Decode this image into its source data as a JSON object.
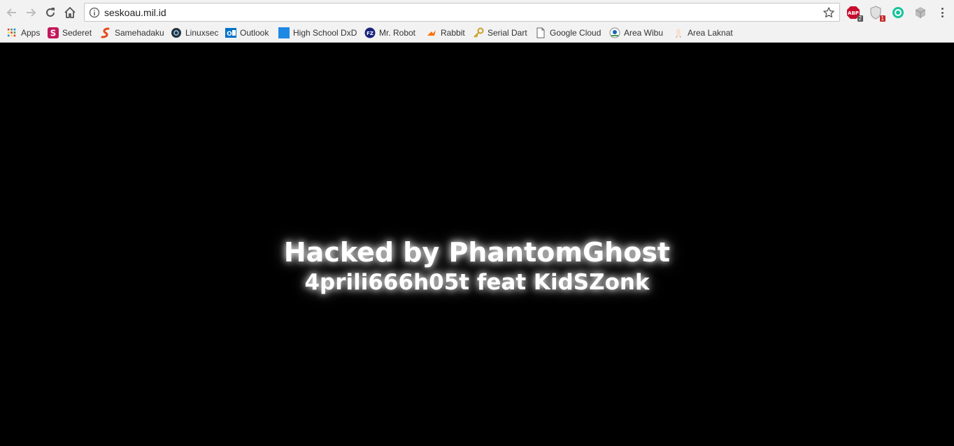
{
  "browser": {
    "url": "seskoau.mil.id",
    "extensions": [
      {
        "name": "adblock-plus",
        "badge": "2",
        "color": "#c70d2c"
      },
      {
        "name": "privacy-shield",
        "badge": "1",
        "color": "#999999"
      },
      {
        "name": "grammarly",
        "color": "#15c39a"
      },
      {
        "name": "extension-cube",
        "color": "#9e9e9e"
      }
    ]
  },
  "bookmarks": [
    {
      "label": "Apps",
      "icon": "apps-grid-icon"
    },
    {
      "label": "Sederet",
      "icon": "sederet-icon"
    },
    {
      "label": "Samehadaku",
      "icon": "samehadaku-icon"
    },
    {
      "label": "Linuxsec",
      "icon": "linuxsec-icon"
    },
    {
      "label": "Outlook",
      "icon": "outlook-icon"
    },
    {
      "label": "High School DxD",
      "icon": "blue-square-icon"
    },
    {
      "label": "Mr. Robot",
      "icon": "fz-icon"
    },
    {
      "label": "Rabbit",
      "icon": "rabbit-icon"
    },
    {
      "label": "Serial Dart",
      "icon": "key-icon"
    },
    {
      "label": "Google Cloud",
      "icon": "page-icon"
    },
    {
      "label": "Area Wibu",
      "icon": "wibu-icon"
    },
    {
      "label": "Area Laknat",
      "icon": "laknat-icon"
    }
  ],
  "page": {
    "line1": "Hacked by PhantomGhost",
    "line2": "4prili666h05t feat KidSZonk"
  },
  "colors": {
    "page_background": "#000000",
    "text": "#ffffff",
    "glow": "#ffffff"
  }
}
